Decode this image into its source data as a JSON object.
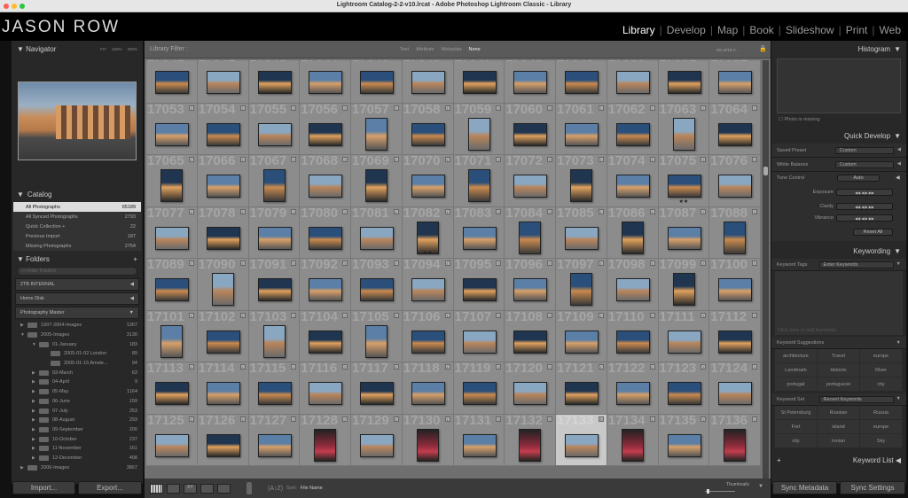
{
  "window": {
    "title": "Lightroom Catalog-2-2-v10.lrcat - Adobe Photoshop Lightroom Classic - Library"
  },
  "brand": {
    "logo": "JASON ROW"
  },
  "modules": [
    "Library",
    "Develop",
    "Map",
    "Book",
    "Slideshow",
    "Print",
    "Web"
  ],
  "navigator": {
    "title": "Navigator",
    "zoom": [
      "FIT",
      "100%",
      "200%"
    ]
  },
  "catalog": {
    "title": "Catalog",
    "items": [
      {
        "label": "All Photographs",
        "count": "65189",
        "selected": true
      },
      {
        "label": "All Synced Photographs",
        "count": "2793"
      },
      {
        "label": "Quick Collection +",
        "count": "22"
      },
      {
        "label": "Previous Import",
        "count": "187"
      },
      {
        "label": "Missing Photographs",
        "count": "2754"
      }
    ]
  },
  "folders": {
    "title": "Folders",
    "filter_placeholder": "Filter Folders",
    "volumes": [
      "2TB INTERNAL",
      "Home Disk",
      "Photography Master"
    ],
    "tree": [
      {
        "name": "1997-2004-Images",
        "count": "1367",
        "level": 0,
        "exp": "▶"
      },
      {
        "name": "2005-Images",
        "count": "3130",
        "level": 0,
        "exp": "▼"
      },
      {
        "name": "01-January",
        "count": "183",
        "level": 1,
        "exp": "▼"
      },
      {
        "name": "2005-01-02 London",
        "count": "89",
        "level": 2,
        "exp": ""
      },
      {
        "name": "2005-01-15 Amste...",
        "count": "94",
        "level": 2,
        "exp": ""
      },
      {
        "name": "03-March",
        "count": "63",
        "level": 1,
        "exp": "▶"
      },
      {
        "name": "04-April",
        "count": "9",
        "level": 1,
        "exp": "▶"
      },
      {
        "name": "05-May",
        "count": "1164",
        "level": 1,
        "exp": "▶"
      },
      {
        "name": "06-June",
        "count": "159",
        "level": 1,
        "exp": "▶"
      },
      {
        "name": "07-July",
        "count": "253",
        "level": 1,
        "exp": "▶"
      },
      {
        "name": "08-August",
        "count": "293",
        "level": 1,
        "exp": "▶"
      },
      {
        "name": "09-September",
        "count": "200",
        "level": 1,
        "exp": "▶"
      },
      {
        "name": "10-October",
        "count": "237",
        "level": 1,
        "exp": "▶"
      },
      {
        "name": "11-November",
        "count": "161",
        "level": 1,
        "exp": "▶"
      },
      {
        "name": "12-December",
        "count": "408",
        "level": 1,
        "exp": "▶"
      },
      {
        "name": "2006-Images",
        "count": "3867",
        "level": 0,
        "exp": "▶"
      }
    ]
  },
  "left_buttons": {
    "import": "Import...",
    "export": "Export..."
  },
  "filter": {
    "label": "Library Filter :",
    "tabs": [
      "Text",
      "Attribute",
      "Metadata",
      "None"
    ],
    "active": "None",
    "preset": "00 LRTS F..."
  },
  "grid": {
    "start": 17041,
    "columns": 12,
    "selected": 17133,
    "orientations": [
      "LLLLLLLLLLLL",
      "LLLLPLPLLLPL",
      "PLPLPLPLPLLL",
      "LLLLLPLPLPLP",
      "LPLLLLLLPLPL",
      "PLPLPLLLLLLL",
      "LLLLLLLLLLLL",
      "LLLPLPLPLPLP"
    ],
    "starred": {
      "17075": "★★",
      "17082": "★★"
    }
  },
  "toolbar": {
    "sort_label": "Sort:",
    "sort_value": "File Name",
    "thumbnails_label": "Thumbnails"
  },
  "histogram": {
    "title": "Histogram",
    "missing": "Photo is missing"
  },
  "quick_develop": {
    "title": "Quick Develop",
    "saved_preset_label": "Saved Preset",
    "saved_preset": "Custom",
    "white_balance_label": "White Balance",
    "white_balance": "Custom",
    "tone_control_label": "Tone Control",
    "auto": "Auto",
    "exposure": "Exposure",
    "clarity": "Clarity",
    "vibrance": "Vibrance",
    "reset": "Reset All"
  },
  "keywording": {
    "title": "Keywording",
    "tags_label": "Keyword Tags",
    "tags_value": "Enter Keywords",
    "add_placeholder": "Click here to add keywords",
    "suggestions_label": "Keyword Suggestions",
    "suggestions": [
      "architecture",
      "Travel",
      "europe",
      "Landmark",
      "Historic",
      "River",
      "portugal",
      "portuguese",
      "city"
    ],
    "set_label": "Keyword Set",
    "set_value": "Recent Keywords",
    "set": [
      "St Petersburg",
      "Russian",
      "Russia",
      "Fort",
      "island",
      "europe",
      "city",
      "Ionian",
      "Sky"
    ]
  },
  "keyword_list": {
    "title": "Keyword List"
  },
  "right_buttons": {
    "sync_metadata": "Sync Metadata",
    "sync_settings": "Sync Settings"
  },
  "colors": {
    "selected_cell": "#c9c9c9",
    "cell": "#8c8c8c",
    "panel": "#282828"
  }
}
